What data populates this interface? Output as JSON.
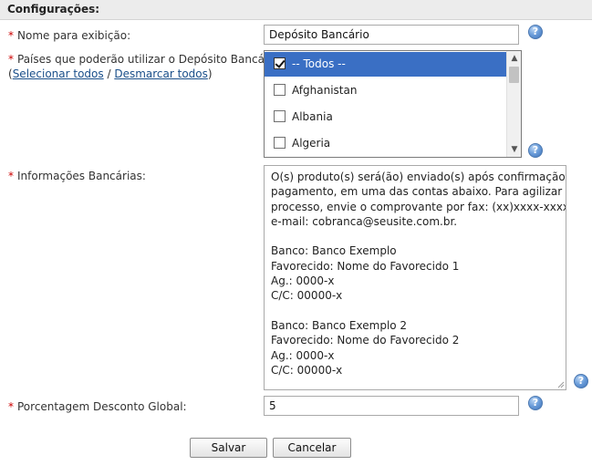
{
  "section": {
    "title": "Configurações:"
  },
  "form": {
    "required_mark": "*",
    "display_name": {
      "label": "Nome para exibição:",
      "value": "Depósito Bancário"
    },
    "countries": {
      "label": "Países que poderão utilizar o Depósito Bancário:",
      "open_paren": "(",
      "select_all": "Selecionar todos",
      "separator": " / ",
      "deselect_all": "Desmarcar todos",
      "close_paren": ")",
      "options": [
        {
          "label": "-- Todos --",
          "checked": true,
          "selected": true
        },
        {
          "label": "Afghanistan",
          "checked": false,
          "selected": false
        },
        {
          "label": "Albania",
          "checked": false,
          "selected": false
        },
        {
          "label": "Algeria",
          "checked": false,
          "selected": false
        }
      ]
    },
    "bank_info": {
      "label": "Informações Bancárias:",
      "lines": [
        "O(s) produto(s) será(ão) enviado(s) após confirmação de",
        "pagamento, em uma das contas abaixo. Para agilizar o",
        "processo, envie o comprovante por fax: (xx)xxxx-xxxx ou",
        "e-mail: cobranca@seusite.com.br.",
        "",
        "Banco: Banco Exemplo",
        "Favorecido: Nome do Favorecido 1",
        "Ag.: 0000-x",
        "C/C: 00000-x",
        "",
        "Banco: Banco Exemplo 2",
        "Favorecido: Nome do Favorecido 2",
        "Ag.: 0000-x",
        "C/C: 00000-x"
      ]
    },
    "global_discount": {
      "label": "Porcentagem Desconto Global:",
      "value": "5"
    },
    "help_icon": "?"
  },
  "buttons": {
    "save": "Salvar",
    "cancel": "Cancelar"
  },
  "colors": {
    "selected_row": "#3a6fc4",
    "required": "#cc0000",
    "link": "#1a4f8a"
  }
}
